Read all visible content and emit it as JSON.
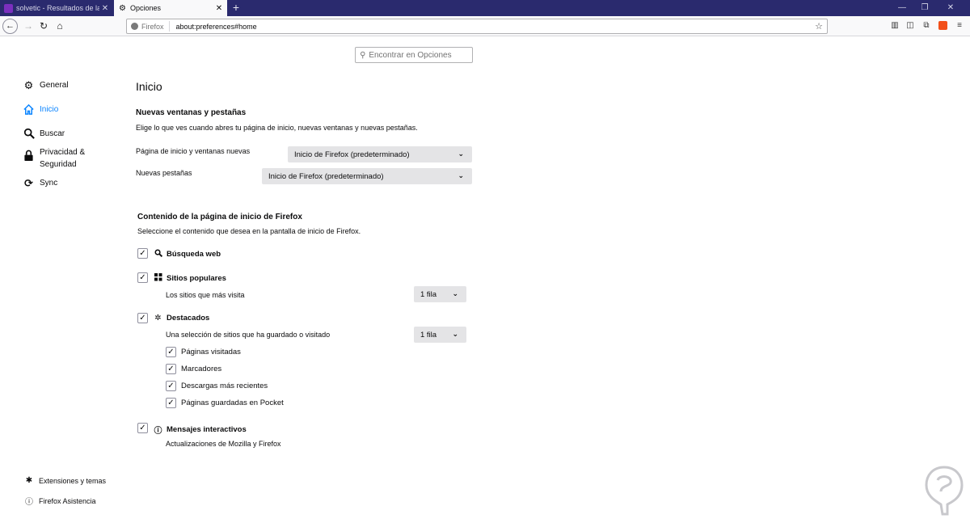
{
  "tabs": [
    {
      "title": "solvetic - Resultados de la búsq",
      "icon": "solvetic-favicon"
    },
    {
      "title": "Opciones",
      "icon": "gear-icon"
    }
  ],
  "navbar": {
    "url_identity": "Firefox",
    "url": "about:preferences#home"
  },
  "search": {
    "placeholder": "Encontrar en Opciones"
  },
  "sidebar": {
    "items": [
      {
        "label": "General",
        "icon": "gear-icon"
      },
      {
        "label": "Inicio",
        "icon": "home-icon",
        "selected": true
      },
      {
        "label": "Buscar",
        "icon": "search-icon"
      },
      {
        "label": "Privacidad & Seguridad",
        "icon": "lock-icon"
      },
      {
        "label": "Sync",
        "icon": "sync-icon"
      }
    ],
    "footer": [
      {
        "label": "Extensiones y temas",
        "icon": "puzzle-icon"
      },
      {
        "label": "Firefox Asistencia",
        "icon": "help-icon"
      }
    ]
  },
  "main": {
    "title": "Inicio",
    "windows_section": {
      "heading": "Nuevas ventanas y pestañas",
      "description": "Elige lo que ves cuando abres tu página de inicio, nuevas ventanas y nuevas pestañas.",
      "homepage_label": "Página de inicio y ventanas nuevas",
      "homepage_value": "Inicio de Firefox (predeterminado)",
      "newtabs_label": "Nuevas pestañas",
      "newtabs_value": "Inicio de Firefox (predeterminado)"
    },
    "content_section": {
      "heading": "Contenido de la página de inicio de Firefox",
      "description": "Seleccione el contenido que desea en la pantalla de inicio de Firefox.",
      "web_search": {
        "label": "Búsqueda web",
        "checked": true
      },
      "top_sites": {
        "label": "Sitios populares",
        "checked": true,
        "sub_label": "Los sitios que más visita",
        "rows": "1 fila"
      },
      "highlights": {
        "label": "Destacados",
        "checked": true,
        "sub_label": "Una selección de sitios que ha guardado o visitado",
        "rows": "1 fila",
        "options": [
          {
            "label": "Páginas visitadas",
            "checked": true
          },
          {
            "label": "Marcadores",
            "checked": true
          },
          {
            "label": "Descargas más recientes",
            "checked": true
          },
          {
            "label": "Páginas guardadas en Pocket",
            "checked": true
          }
        ]
      },
      "snippets": {
        "label": "Mensajes interactivos",
        "checked": true,
        "sub_label": "Actualizaciones de Mozilla y Firefox"
      }
    }
  },
  "colors": {
    "accent": "#0a84ff",
    "tabbar": "#2a2a6e",
    "select_bg": "#e4e4e6"
  }
}
